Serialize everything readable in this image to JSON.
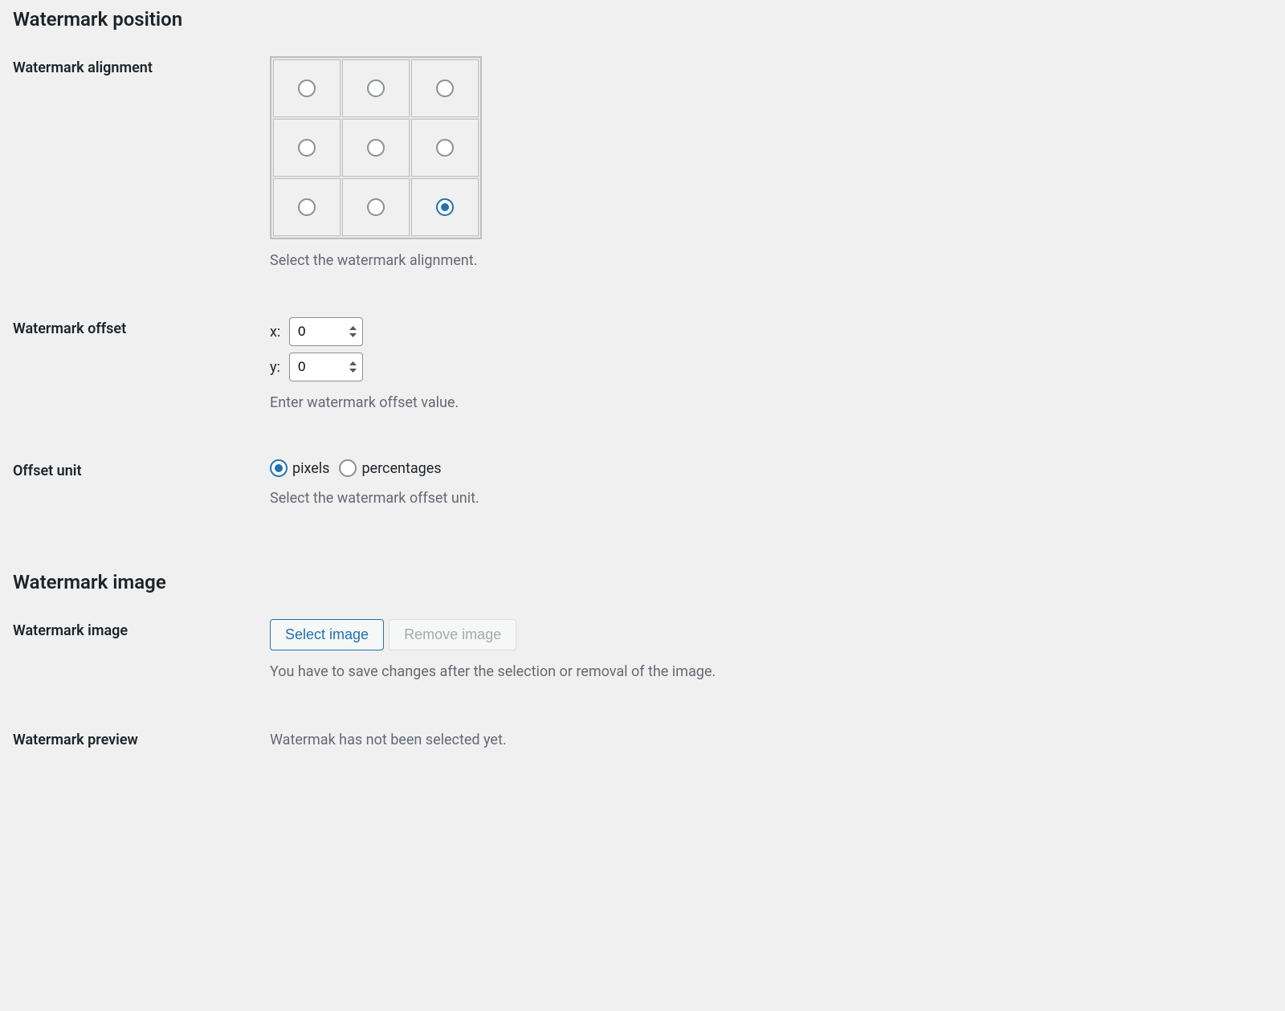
{
  "section_position": {
    "heading": "Watermark position",
    "alignment": {
      "label": "Watermark alignment",
      "description": "Select the watermark alignment.",
      "selected_index": 8
    },
    "offset": {
      "label": "Watermark offset",
      "x_label": "x:",
      "y_label": "y:",
      "x_value": "0",
      "y_value": "0",
      "description": "Enter watermark offset value."
    },
    "unit": {
      "label": "Offset unit",
      "option_pixels": "pixels",
      "option_percentages": "percentages",
      "selected": "pixels",
      "description": "Select the watermark offset unit."
    }
  },
  "section_image": {
    "heading": "Watermark image",
    "image": {
      "label": "Watermark image",
      "select_button": "Select image",
      "remove_button": "Remove image",
      "description": "You have to save changes after the selection or removal of the image."
    },
    "preview": {
      "label": "Watermark preview",
      "message": "Watermak has not been selected yet."
    }
  }
}
